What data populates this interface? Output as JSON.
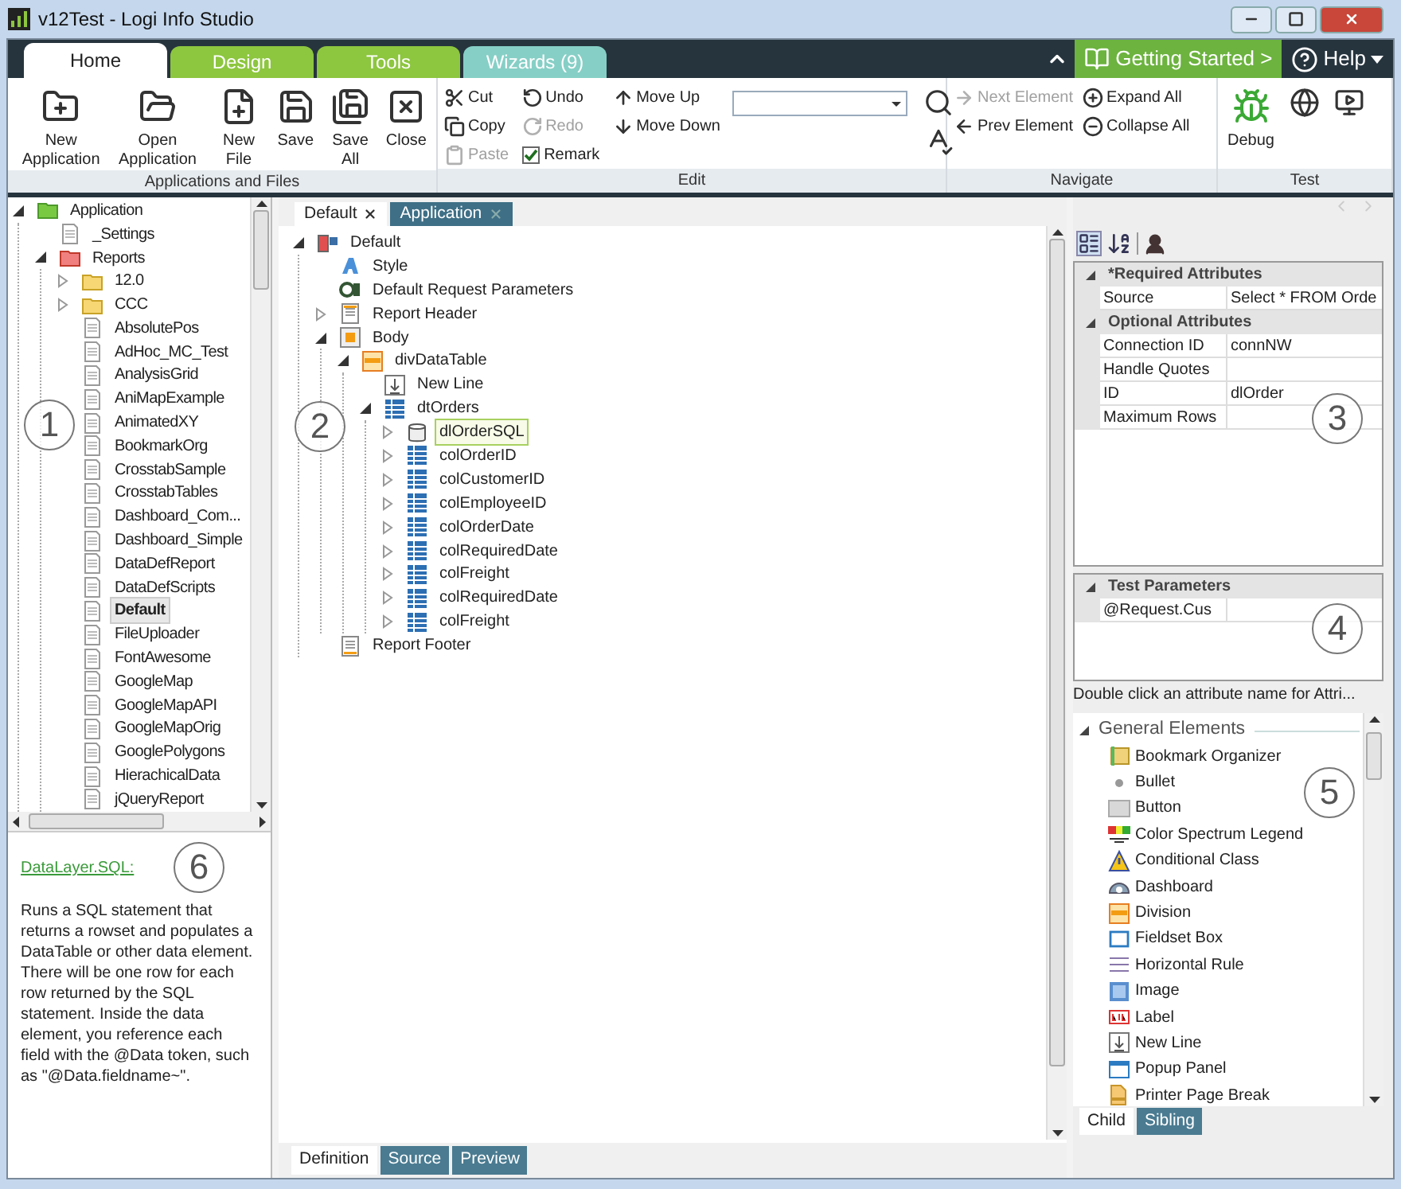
{
  "window": {
    "title": "v12Test - Logi Info Studio"
  },
  "ribbon_tabs": [
    {
      "label": "Home",
      "selected": true,
      "color": "#ffffff"
    },
    {
      "label": "Design",
      "selected": false,
      "color": "#8dc63f"
    },
    {
      "label": "Tools",
      "selected": false,
      "color": "#8dc63f"
    },
    {
      "label": "Wizards (9)",
      "selected": false,
      "color": "#86cfc6"
    }
  ],
  "getting_started": {
    "label": "Getting Started >"
  },
  "help": {
    "label": "Help"
  },
  "ribbon_groups": [
    {
      "label": "Applications and Files",
      "columns": [
        [
          {
            "kind": "large",
            "label": "New Application"
          }
        ],
        [
          {
            "kind": "large",
            "label": "Open Application"
          }
        ],
        [
          {
            "kind": "large",
            "label": "New File"
          }
        ],
        [
          {
            "kind": "large",
            "label": "Save"
          }
        ],
        [
          {
            "kind": "large",
            "label": "Save All"
          }
        ],
        [
          {
            "kind": "large",
            "label": "Close"
          }
        ]
      ]
    },
    {
      "label": "Edit",
      "columns": [
        [
          {
            "kind": "small",
            "label": "Cut",
            "disabled": false
          },
          {
            "kind": "small",
            "label": "Copy",
            "disabled": false
          },
          {
            "kind": "small",
            "label": "Paste",
            "disabled": true
          }
        ],
        [
          {
            "kind": "small",
            "label": "Undo",
            "disabled": false
          },
          {
            "kind": "small",
            "label": "Redo",
            "disabled": true
          },
          {
            "kind": "checkbox",
            "label": "Remark",
            "checked": true
          }
        ],
        [
          {
            "kind": "small",
            "label": "Move Up",
            "disabled": false
          },
          {
            "kind": "small",
            "label": "Move Down",
            "disabled": false
          }
        ],
        [
          {
            "kind": "field"
          }
        ],
        [
          {
            "kind": "tool"
          },
          {
            "kind": "tool"
          }
        ]
      ]
    },
    {
      "label": "Navigate",
      "columns": [
        [
          {
            "kind": "small",
            "label": "Next Element",
            "disabled": true
          },
          {
            "kind": "small",
            "label": "Prev Element",
            "disabled": false
          }
        ],
        [
          {
            "kind": "small",
            "label": "Expand All",
            "disabled": false
          },
          {
            "kind": "small",
            "label": "Collapse All",
            "disabled": false
          }
        ]
      ]
    },
    {
      "label": "Test",
      "columns": [
        [
          {
            "kind": "large",
            "label": "Debug"
          }
        ],
        [
          {
            "kind": "tool"
          }
        ],
        [
          {
            "kind": "tool"
          }
        ]
      ]
    }
  ],
  "left_tree": [
    {
      "label": "Application",
      "kind": "app",
      "expanded": true,
      "selected": false,
      "children": [
        {
          "label": "_Settings",
          "kind": "file",
          "selected": false
        },
        {
          "label": "Reports",
          "kind": "reports",
          "expanded": true,
          "selected": false,
          "children": [
            {
              "label": "12.0",
              "kind": "folder",
              "expanded": false,
              "selected": false
            },
            {
              "label": "CCC",
              "kind": "folder",
              "expanded": false,
              "selected": false
            },
            {
              "label": "AbsolutePos",
              "kind": "file",
              "selected": false
            },
            {
              "label": "AdHoc_MC_Test",
              "kind": "file",
              "selected": false
            },
            {
              "label": "AnalysisGrid",
              "kind": "file",
              "selected": false
            },
            {
              "label": "AniMapExample",
              "kind": "file",
              "selected": false
            },
            {
              "label": "AnimatedXY",
              "kind": "file",
              "selected": false
            },
            {
              "label": "BookmarkOrg",
              "kind": "file",
              "selected": false
            },
            {
              "label": "CrosstabSample",
              "kind": "file",
              "selected": false
            },
            {
              "label": "CrosstabTables",
              "kind": "file",
              "selected": false
            },
            {
              "label": "Dashboard_Com...",
              "kind": "file",
              "selected": false
            },
            {
              "label": "Dashboard_Simple",
              "kind": "file",
              "selected": false
            },
            {
              "label": "DataDefReport",
              "kind": "file",
              "selected": false
            },
            {
              "label": "DataDefScripts",
              "kind": "file",
              "selected": false
            },
            {
              "label": "Default",
              "kind": "file",
              "selected": true
            },
            {
              "label": "FileUploader",
              "kind": "file",
              "selected": false
            },
            {
              "label": "FontAwesome",
              "kind": "file",
              "selected": false
            },
            {
              "label": "GoogleMap",
              "kind": "file",
              "selected": false
            },
            {
              "label": "GoogleMapAPI",
              "kind": "file",
              "selected": false
            },
            {
              "label": "GoogleMapOrig",
              "kind": "file",
              "selected": false
            },
            {
              "label": "GooglePolygons",
              "kind": "file",
              "selected": false
            },
            {
              "label": "HierachicalData",
              "kind": "file",
              "selected": false
            },
            {
              "label": "jQueryReport",
              "kind": "file",
              "selected": false
            }
          ]
        }
      ]
    }
  ],
  "description": {
    "link": "DataLayer.SQL:",
    "text": "Runs a SQL statement that returns a rowset and populates a DataTable or other data element. There will be one row for each row returned by the SQL statement. Inside the data element, you reference each field with the @Data token, such as \"@Data.fieldname~\"."
  },
  "document_tabs": [
    {
      "label": "Default",
      "selected": true
    },
    {
      "label": "Application",
      "selected": false
    }
  ],
  "definition_tree": [
    {
      "label": "Default",
      "kind": "report",
      "expanded": true,
      "selected": false,
      "children": [
        {
          "label": "Style",
          "kind": "style",
          "selected": false
        },
        {
          "label": "Default Request Parameters",
          "kind": "params",
          "selected": false
        },
        {
          "label": "Report Header",
          "kind": "header",
          "expanded": false,
          "selected": false
        },
        {
          "label": "Body",
          "kind": "body",
          "expanded": true,
          "selected": false,
          "children": [
            {
              "label": "divDataTable",
              "kind": "division",
              "expanded": true,
              "selected": false,
              "children": [
                {
                  "label": "New Line",
                  "kind": "newline",
                  "selected": false
                },
                {
                  "label": "dtOrders",
                  "kind": "datatable",
                  "expanded": true,
                  "selected": false,
                  "children": [
                    {
                      "label": "dlOrderSQL",
                      "kind": "datalayer",
                      "expanded": false,
                      "selected": true
                    },
                    {
                      "label": "colOrderID",
                      "kind": "column",
                      "expanded": false,
                      "selected": false
                    },
                    {
                      "label": "colCustomerID",
                      "kind": "column",
                      "expanded": false,
                      "selected": false
                    },
                    {
                      "label": "colEmployeeID",
                      "kind": "column",
                      "expanded": false,
                      "selected": false
                    },
                    {
                      "label": "colOrderDate",
                      "kind": "column",
                      "expanded": false,
                      "selected": false
                    },
                    {
                      "label": "colRequiredDate",
                      "kind": "column",
                      "expanded": false,
                      "selected": false
                    },
                    {
                      "label": "colFreight",
                      "kind": "column",
                      "expanded": false,
                      "selected": false
                    },
                    {
                      "label": "colRequiredDate",
                      "kind": "column",
                      "expanded": false,
                      "selected": false
                    },
                    {
                      "label": "colFreight",
                      "kind": "column",
                      "expanded": false,
                      "selected": false
                    }
                  ]
                }
              ]
            }
          ]
        },
        {
          "label": "Report Footer",
          "kind": "footer",
          "selected": false
        }
      ]
    }
  ],
  "view_tabs": [
    {
      "label": "Definition",
      "selected": true
    },
    {
      "label": "Source",
      "selected": false
    },
    {
      "label": "Preview",
      "selected": false
    }
  ],
  "attributes": [
    {
      "title": "*Required Attributes",
      "expanded": true,
      "rows": [
        {
          "name": "Source",
          "value": "Select * FROM Orde"
        }
      ]
    },
    {
      "title": "Optional Attributes",
      "expanded": true,
      "rows": [
        {
          "name": "Connection ID",
          "value": "connNW"
        },
        {
          "name": "Handle Quotes"
        },
        {
          "name": "ID",
          "value": "dlOrder"
        },
        {
          "name": "Maximum Rows"
        }
      ]
    }
  ],
  "test_parameters": {
    "title": "Test Parameters",
    "expanded": true,
    "rows": [
      {
        "name": "@Request.Cus"
      }
    ]
  },
  "hint": "Double click an attribute name for Attri...",
  "elements": {
    "group": "General Elements",
    "expanded": true,
    "items": [
      {
        "label": "Bookmark Organizer",
        "kind": "bookmark"
      },
      {
        "label": "Bullet",
        "kind": "bullet"
      },
      {
        "label": "Button",
        "kind": "button"
      },
      {
        "label": "Color Spectrum Legend",
        "kind": "spectrum"
      },
      {
        "label": "Conditional Class",
        "kind": "conditional"
      },
      {
        "label": "Dashboard",
        "kind": "dashboard"
      },
      {
        "label": "Division",
        "kind": "division"
      },
      {
        "label": "Fieldset Box",
        "kind": "fieldset"
      },
      {
        "label": "Horizontal Rule",
        "kind": "rule"
      },
      {
        "label": "Image",
        "kind": "image"
      },
      {
        "label": "Label",
        "kind": "label"
      },
      {
        "label": "New Line",
        "kind": "newline"
      },
      {
        "label": "Popup Panel",
        "kind": "popup"
      },
      {
        "label": "Printer Page Break",
        "kind": "pagebreak"
      }
    ]
  },
  "element_tabs": [
    {
      "label": "Child",
      "selected": true
    },
    {
      "label": "Sibling",
      "selected": false
    }
  ],
  "callouts": [
    {
      "label": "1"
    },
    {
      "label": "2"
    },
    {
      "label": "3"
    },
    {
      "label": "4"
    },
    {
      "label": "5"
    },
    {
      "label": "6"
    }
  ]
}
